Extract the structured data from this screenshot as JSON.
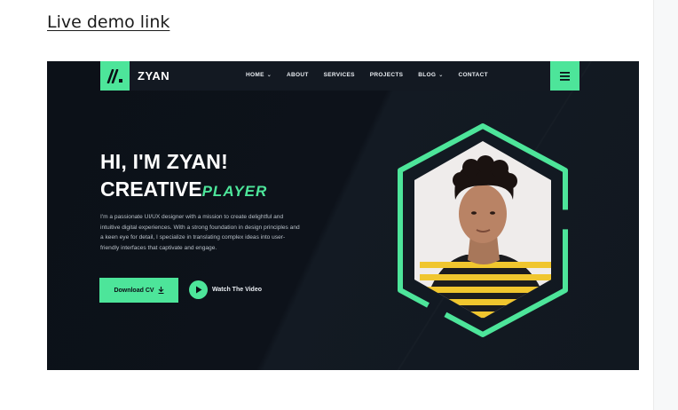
{
  "link": {
    "text": "Live demo link"
  },
  "site": {
    "brand": "ZYAN",
    "nav": [
      {
        "label": "HOME",
        "dropdown": true
      },
      {
        "label": "ABOUT",
        "dropdown": false
      },
      {
        "label": "SERVICES",
        "dropdown": false
      },
      {
        "label": "PROJECTS",
        "dropdown": false
      },
      {
        "label": "BLOG",
        "dropdown": true
      },
      {
        "label": "CONTACT",
        "dropdown": false
      }
    ],
    "hero": {
      "line1": "HI, I'M ZYAN!",
      "line2_main": "CREATIVE",
      "line2_accent": "PLAYER",
      "intro_lines": [
        "I'm a passionate UI/UX designer with a mission to create delightful and",
        "intuitive digital experiences. With a strong foundation in design principles and",
        "a keen eye for detail, I specialize in translating complex ideas into user-",
        "friendly interfaces that captivate and engage."
      ],
      "cv_button": "Download CV",
      "video_button": "Watch The Video"
    }
  },
  "colors": {
    "accent": "#4de59a",
    "background": "#0b0f16",
    "navbar": "#131922"
  },
  "icons": {
    "logo": "slash-logo-icon",
    "menu": "hamburger-icon",
    "download": "download-icon",
    "play": "play-icon"
  }
}
